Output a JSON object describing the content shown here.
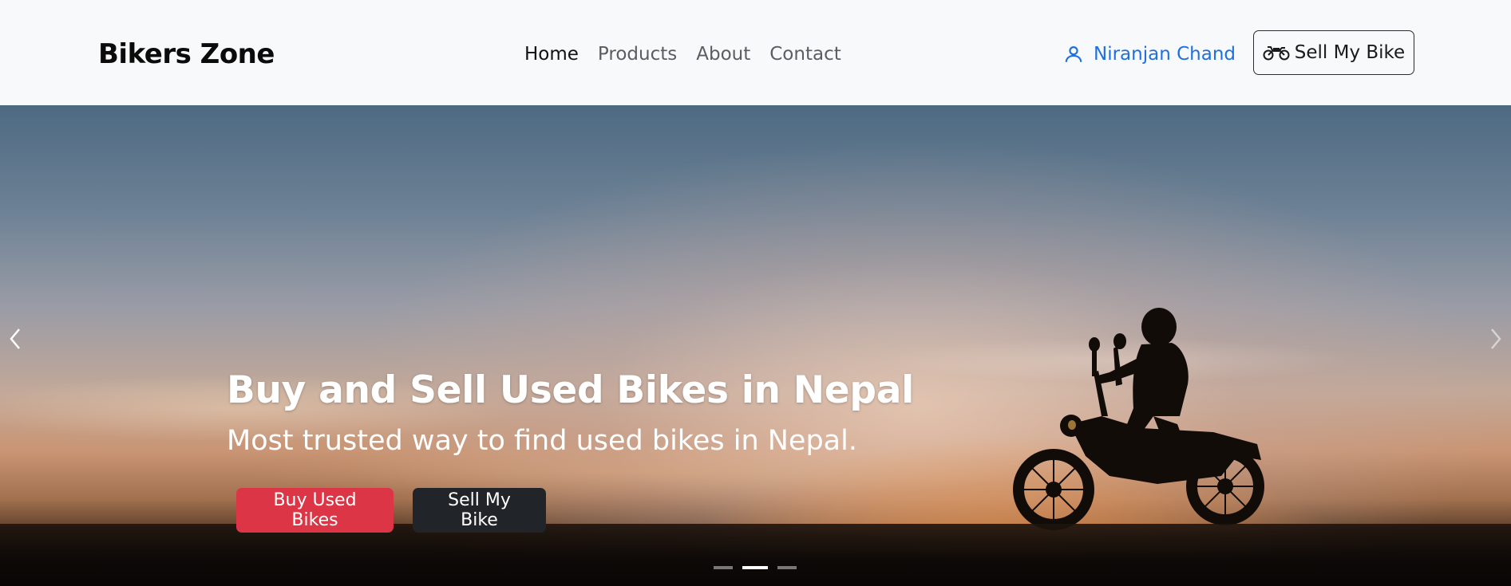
{
  "navbar": {
    "brand": "Bikers Zone",
    "links": [
      {
        "label": "Home",
        "active": true
      },
      {
        "label": "Products",
        "active": false
      },
      {
        "label": "About",
        "active": false
      },
      {
        "label": "Contact",
        "active": false
      }
    ],
    "user_name": "Niranjan Chand",
    "sell_button_label": "Sell My Bike",
    "user_color": "#1f6fe0"
  },
  "hero": {
    "title": "Buy and Sell Used Bikes in Nepal",
    "subtitle": "Most trusted way to find used bikes in Nepal.",
    "buy_button_label": "Buy Used Bikes",
    "sell_button_label": "Sell My Bike",
    "buy_button_color": "#dc3545",
    "sell_button_color": "#212529",
    "active_slide": 2,
    "slide_count": 3
  },
  "icons": {
    "user": "person-icon",
    "sell": "motorcycle-icon",
    "prev": "chevron-left-icon",
    "next": "chevron-right-icon"
  }
}
